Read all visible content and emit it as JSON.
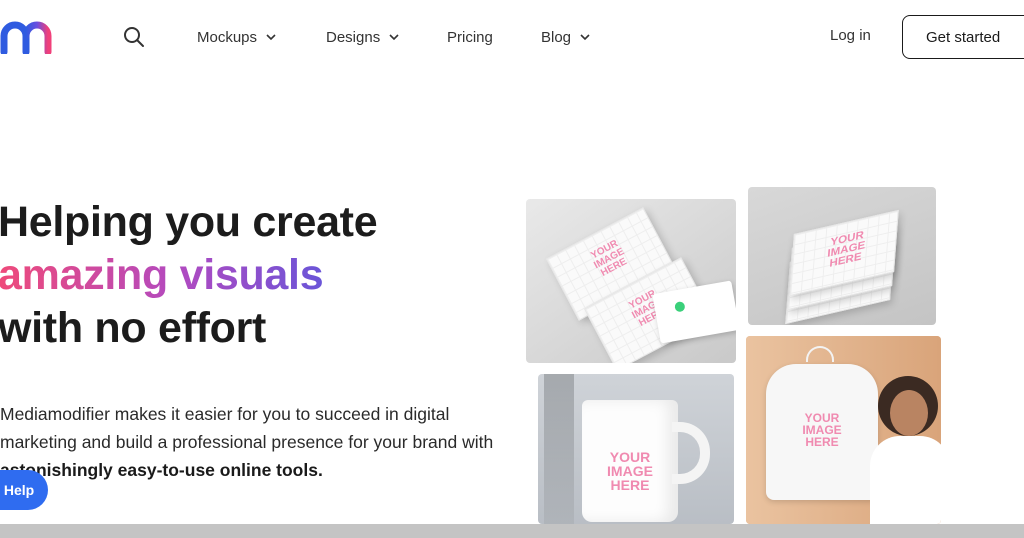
{
  "header": {
    "logo_icon": "mediamodifier-m-logo",
    "search_icon": "search-icon",
    "nav": [
      {
        "label": "Mockups",
        "has_dropdown": true
      },
      {
        "label": "Designs",
        "has_dropdown": true
      },
      {
        "label": "Pricing",
        "has_dropdown": false
      },
      {
        "label": "Blog",
        "has_dropdown": true
      }
    ],
    "login_label": "Log in",
    "cta_label": "Get started"
  },
  "hero": {
    "title_line1": "Helping you create",
    "title_line2": "amazing visuals",
    "title_line3": "with no effort",
    "desc_part1": "Mediamodifier makes it easier for you to succeed in digital marketing and build a professional presence for your brand with ",
    "desc_bold": "astonishingly easy-to-use online tools.",
    "placeholder_text": "YOUR IMAGE HERE"
  },
  "help_label": "Help",
  "colors": {
    "gradient_start": "#ef4a7a",
    "gradient_mid": "#b24ac0",
    "gradient_end": "#6a55d8",
    "help_button": "#2f6cf0",
    "logo_blue": "#3b5bdb",
    "logo_pink": "#f0407a"
  }
}
